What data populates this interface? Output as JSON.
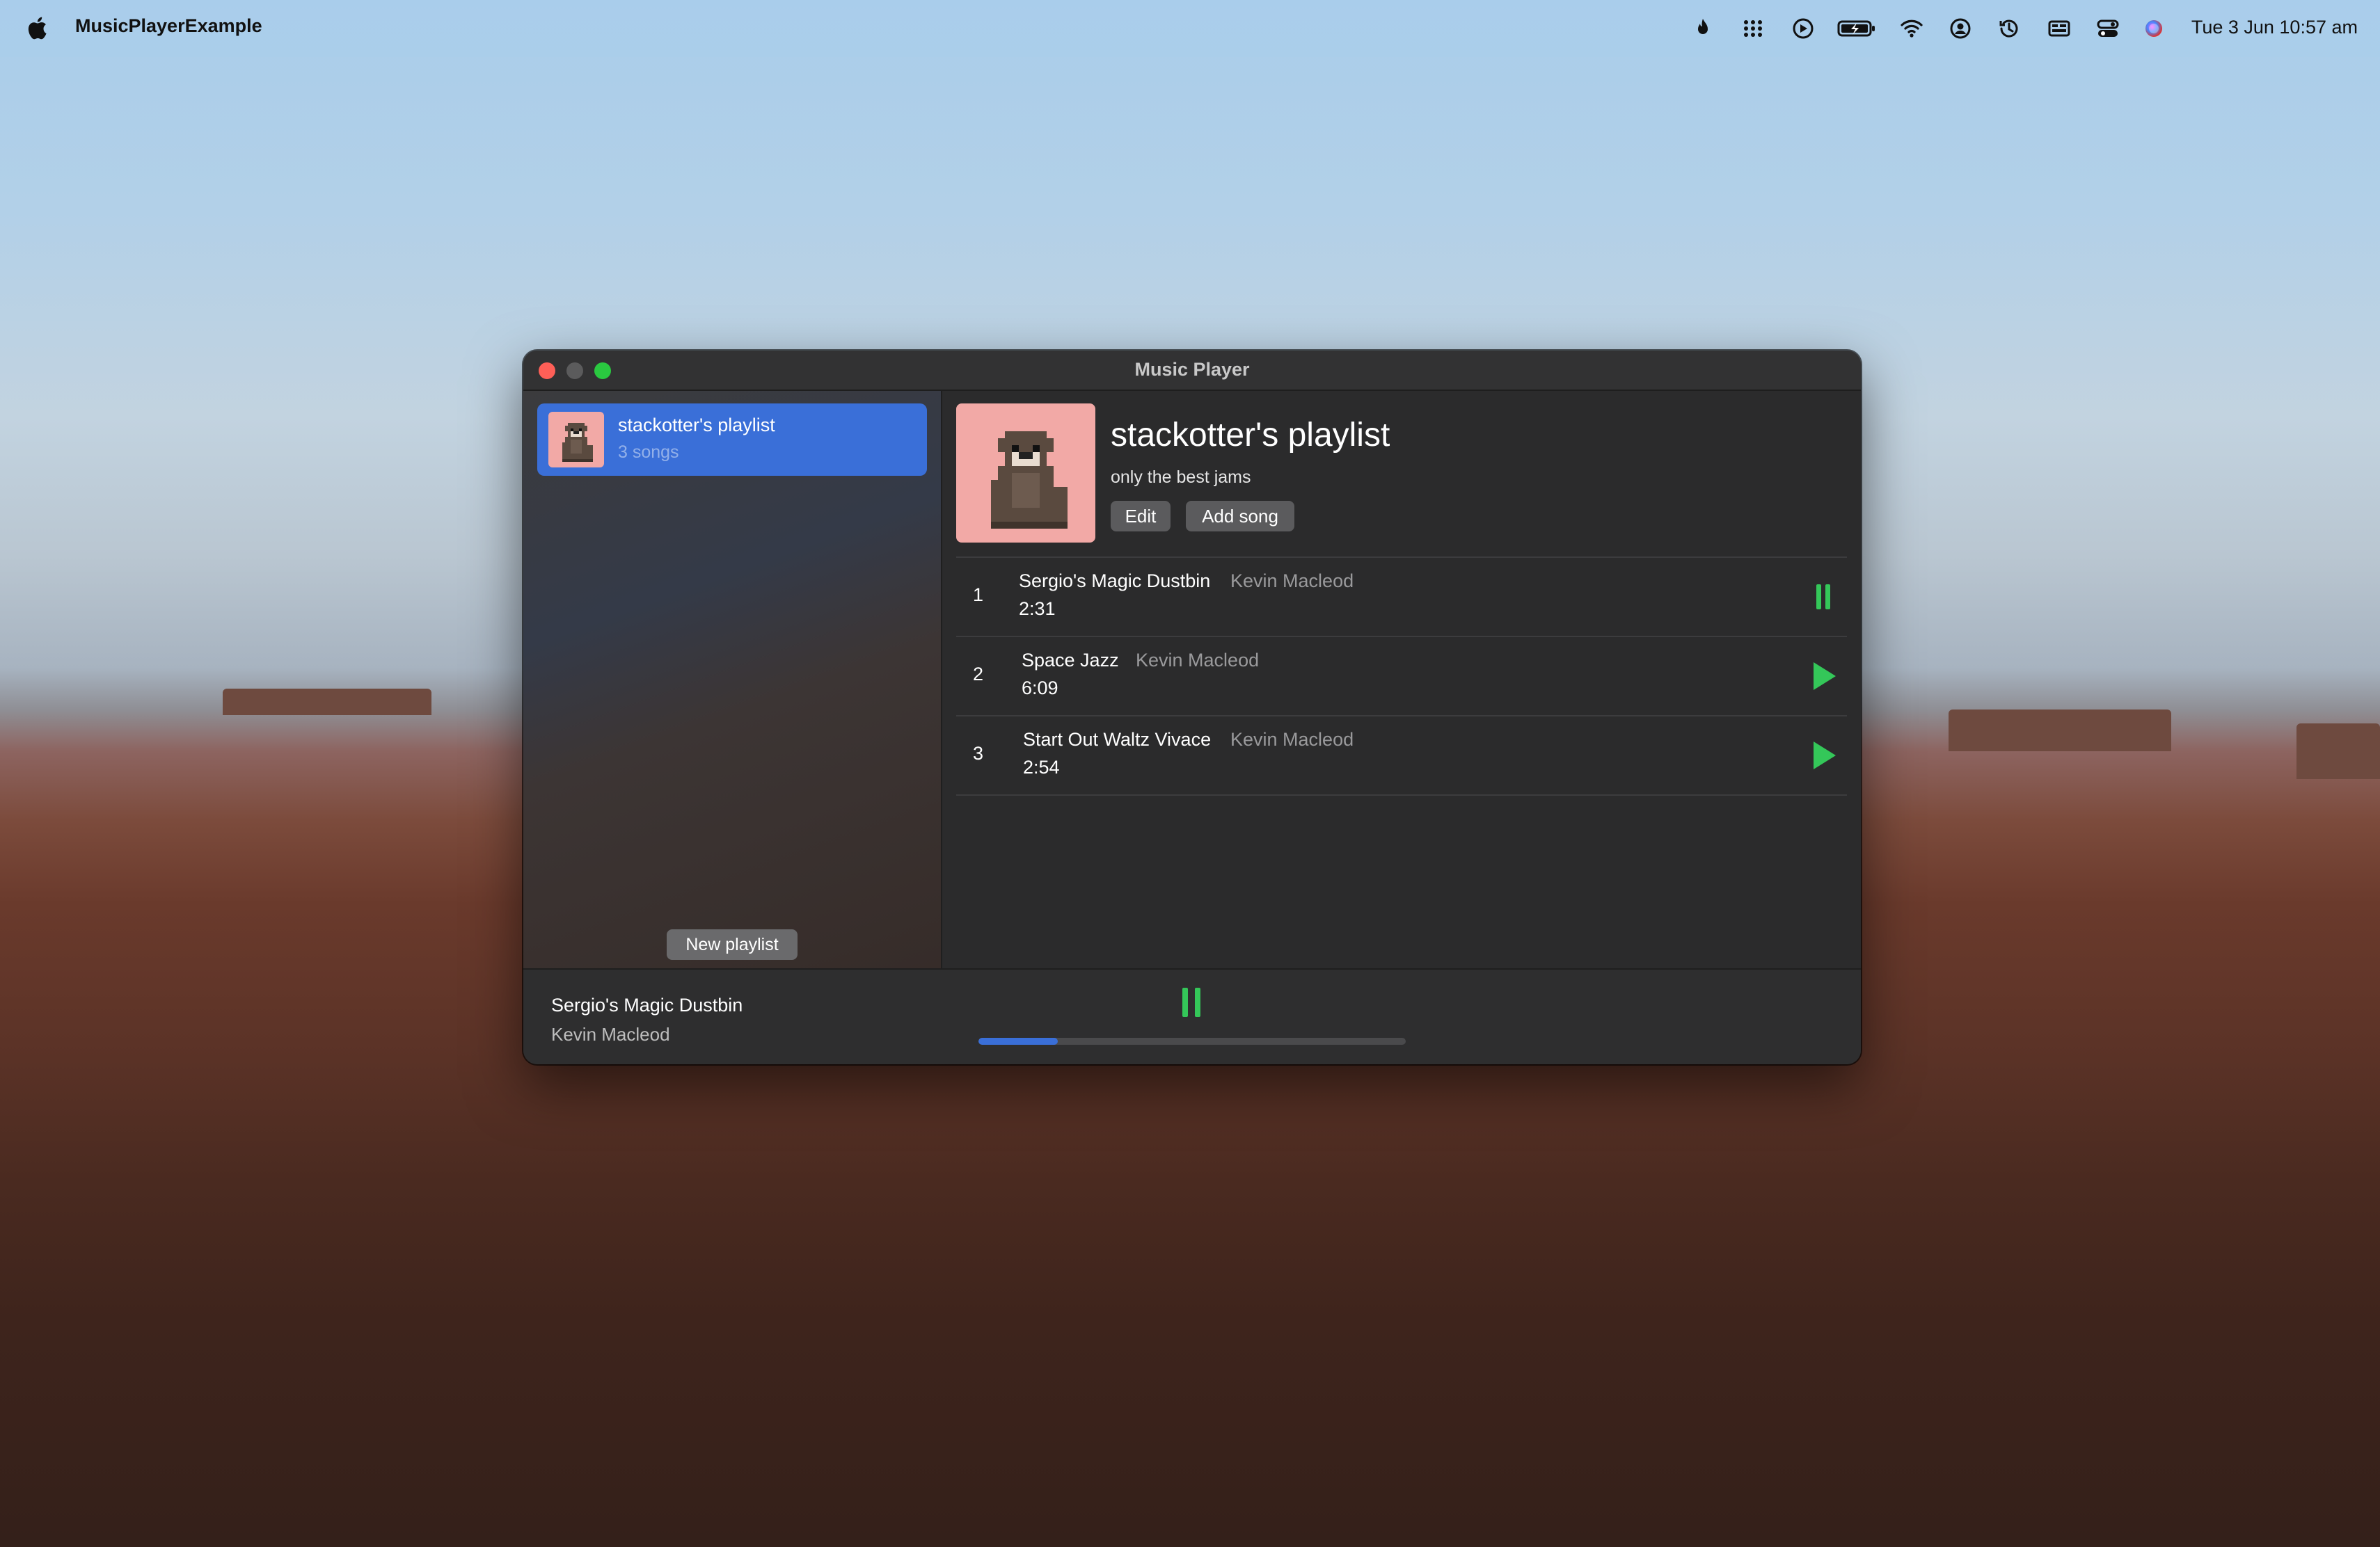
{
  "menubar": {
    "app_name": "MusicPlayerExample",
    "clock": "Tue 3 Jun  10:57 am",
    "icons": [
      "flame-icon",
      "dots-grid-icon",
      "play-circle-icon",
      "battery-charging-icon",
      "wifi-icon",
      "user-circle-icon",
      "time-machine-icon",
      "display-icon",
      "control-center-icon",
      "siri-icon"
    ]
  },
  "window": {
    "title": "Music Player"
  },
  "sidebar": {
    "playlists": [
      {
        "name": "stackotter's playlist",
        "count": "3 songs"
      }
    ],
    "new_playlist_label": "New playlist"
  },
  "playlist": {
    "title": "stackotter's playlist",
    "description": "only the best jams",
    "edit_label": "Edit",
    "add_song_label": "Add song",
    "songs": [
      {
        "number": "1",
        "title": "Sergio's Magic Dustbin",
        "artist": "Kevin Macleod",
        "duration": "2:31",
        "state": "playing"
      },
      {
        "number": "2",
        "title": "Space Jazz",
        "artist": "Kevin Macleod",
        "duration": "6:09",
        "state": "paused"
      },
      {
        "number": "3",
        "title": "Start Out Waltz Vivace",
        "artist": "Kevin Macleod",
        "duration": "2:54",
        "state": "paused"
      }
    ]
  },
  "now_playing": {
    "title": "Sergio's Magic Dustbin",
    "artist": "Kevin Macleod",
    "progress": 0.185
  },
  "colors": {
    "accent_blue": "#3a6fd8",
    "play_green": "#34c759",
    "cover_pink": "#f2a9a6"
  }
}
